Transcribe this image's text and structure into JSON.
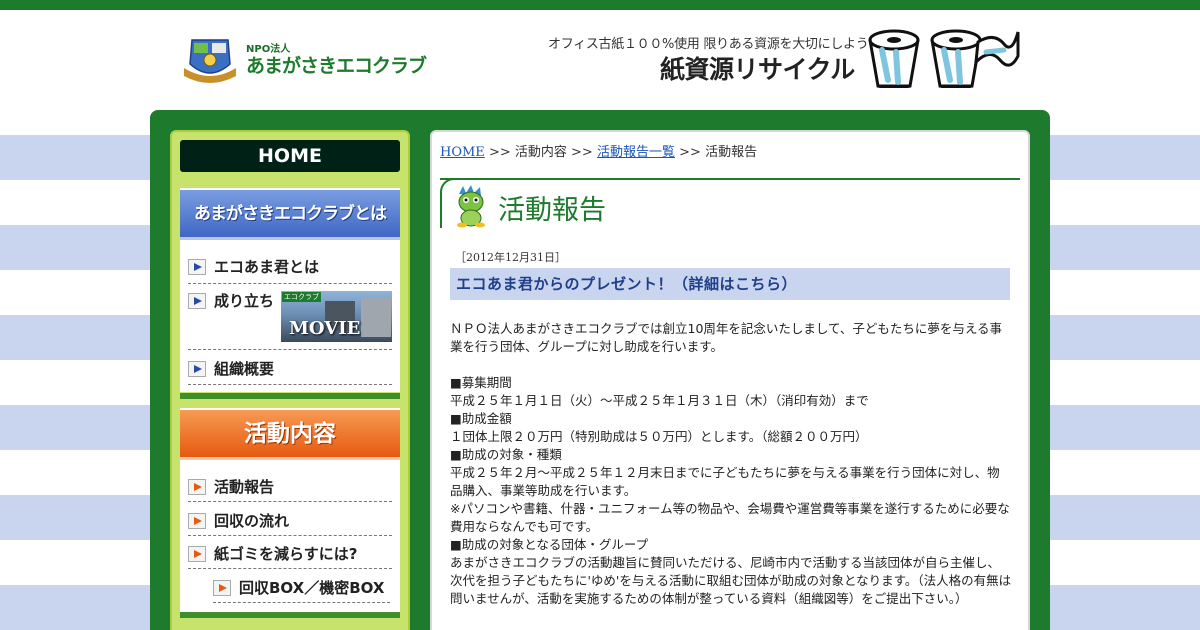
{
  "header": {
    "logo_small": "NPO法人",
    "logo_name": "あまがさきエコクラブ",
    "tagline": "オフィス古紙１００%使用 限りある資源を大切にしよう!",
    "title": "紙資源リサイクル"
  },
  "sidebar": {
    "home_label": "HOME",
    "about_header": "あまがさきエコクラブとは",
    "about_items": [
      {
        "label": "エコあま君とは"
      },
      {
        "label": "成り立ち"
      },
      {
        "label": "組織概要"
      }
    ],
    "movie": {
      "badge": "エコクラブ",
      "label": "MOVIE"
    },
    "activity_header": "活動内容",
    "activity_items": [
      {
        "label": "活動報告"
      },
      {
        "label": "回収の流れ"
      },
      {
        "label": "紙ゴミを減らすには?"
      },
      {
        "label": "回収BOX／機密BOX"
      }
    ]
  },
  "breadcrumb": {
    "home": "HOME",
    "sep": ">>",
    "activity": "活動内容",
    "list": "活動報告一覧",
    "current": "活動報告"
  },
  "content": {
    "page_title": "活動報告",
    "date": "［2012年12月31日］",
    "post_title": "エコあま君からのプレゼント！（詳細はこちら）",
    "lines": [
      "ＮＰＯ法人あまがさきエコクラブでは創立10周年を記念いたしまして、子どもたちに夢を与える事業を行う団体、グループに対し助成を行います。",
      "",
      "■募集期間",
      "平成２５年１月１日（火）～平成２５年１月３１日（木）（消印有効）まで",
      "■助成金額",
      "１団体上限２０万円（特別助成は５０万円）とします。（総額２００万円）",
      "■助成の対象・種類",
      "平成２５年２月～平成２５年１２月末日までに子どもたちに夢を与える事業を行う団体に対し、物品購入、事業等助成を行います。",
      "※パソコンや書籍、什器・ユニフォーム等の物品や、会場費や運営費等事業を遂行するために必要な費用ならなんでも可です。",
      "■助成の対象となる団体・グループ",
      "あまがさきエコクラブの活動趣旨に賛同いただける、尼崎市内で活動する当該団体が自ら主催し、次代を担う子どもたちに'ゆめ'を与える活動に取組む団体が助成の対象となります。（法人格の有無は問いませんが、活動を実施するための体制が整っている資料（組織図等）をご提出下さい。）"
    ]
  },
  "colors": {
    "green": "#1e7a2c",
    "stripe": "#c9d4ee",
    "sidebar_bg": "#c8e36b",
    "blue_header": "#3f67c4",
    "orange_header": "#e65a10"
  }
}
